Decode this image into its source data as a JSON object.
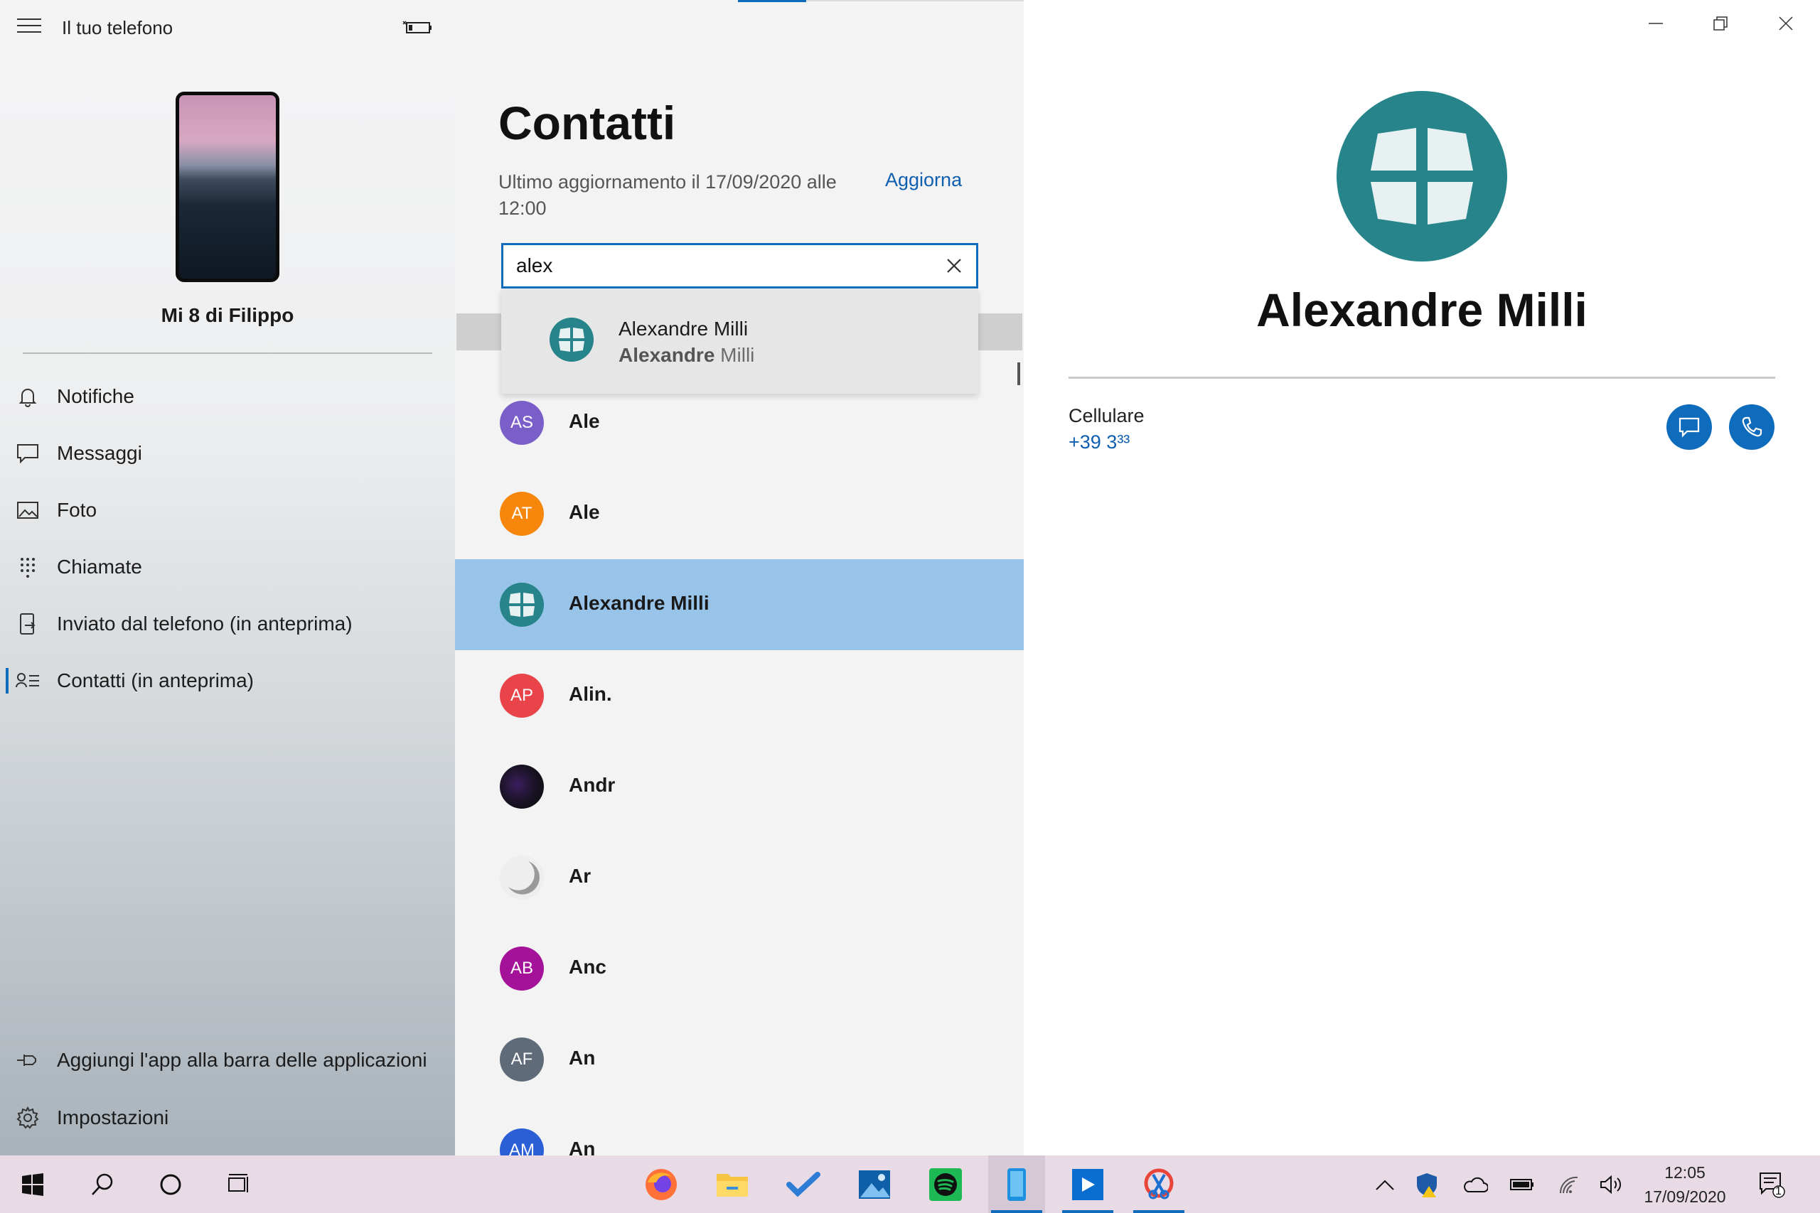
{
  "sidebar": {
    "app_title": "Il tuo telefono",
    "device_name": "Mi 8 di Filippo",
    "nav": [
      {
        "label": "Notifiche",
        "icon": "bell-icon"
      },
      {
        "label": "Messaggi",
        "icon": "message-icon"
      },
      {
        "label": "Foto",
        "icon": "photo-icon"
      },
      {
        "label": "Chiamate",
        "icon": "dialpad-icon"
      },
      {
        "label": "Inviato dal telefono (in anteprima)",
        "icon": "phone-send-icon"
      },
      {
        "label": "Contatti (in anteprima)",
        "icon": "contacts-icon"
      }
    ],
    "bottom": [
      {
        "label": "Aggiungi l'app alla barra delle applicazioni",
        "icon": "pin-icon"
      },
      {
        "label": "Impostazioni",
        "icon": "gear-icon"
      }
    ]
  },
  "contacts": {
    "title": "Contatti",
    "last_update": "Ultimo aggiornamento il 17/09/2020 alle 12:00",
    "refresh_label": "Aggiorna",
    "search_value": "alex",
    "suggestion": {
      "name": "Alexandre Milli",
      "sub_bold": "Alexandre",
      "sub_rest": " Milli"
    },
    "list": [
      {
        "initials": "AS",
        "name": "Ale",
        "color": "#7b5fc9"
      },
      {
        "initials": "AT",
        "name": "Ale",
        "color": "#f7860c"
      },
      {
        "initials": "",
        "name": "Alexandre Milli",
        "color": "#27848a"
      },
      {
        "initials": "AP",
        "name": "Alin.",
        "color": "#e8444a"
      },
      {
        "initials": "",
        "name": "Andr",
        "color": "#14101c"
      },
      {
        "initials": "",
        "name": "Ar",
        "color": "#e8e8e8"
      },
      {
        "initials": "AB",
        "name": "Anc",
        "color": "#a5129a"
      },
      {
        "initials": "AF",
        "name": "An",
        "color": "#5f6b78"
      },
      {
        "initials": "AM",
        "name": "An",
        "color": "#2a5fd6"
      }
    ],
    "selected_index": 2
  },
  "detail": {
    "name": "Alexandre Milli",
    "phone_type": "Cellulare",
    "phone_number": "+39 3³³",
    "message_button": "message-icon",
    "call_button": "phone-call-icon"
  },
  "window_controls": [
    "minimize-icon",
    "restore-icon",
    "close-icon"
  ],
  "taskbar": {
    "time": "12:05",
    "date": "17/09/2020",
    "notification_count": "1",
    "apps": [
      "firefox-icon",
      "file-explorer-icon",
      "todo-icon",
      "photos-icon",
      "spotify-icon",
      "your-phone-icon",
      "app-icon",
      "snip-icon"
    ]
  }
}
